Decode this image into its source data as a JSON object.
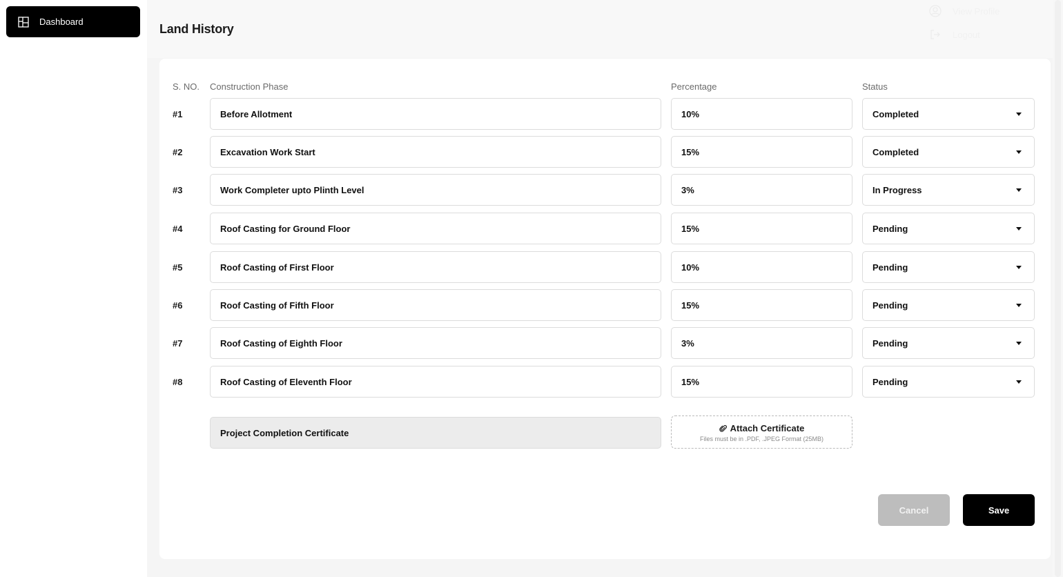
{
  "sidebar": {
    "items": [
      {
        "label": "Dashboard",
        "icon": "layout-icon"
      }
    ]
  },
  "header": {
    "title": "Land History",
    "user_menu": [
      {
        "label": "View Profile",
        "icon": "user-circle-icon"
      },
      {
        "label": "Logout",
        "icon": "logout-icon"
      }
    ]
  },
  "table": {
    "columns": {
      "sno": "S. NO.",
      "phase": "Construction Phase",
      "percentage": "Percentage",
      "status": "Status"
    },
    "rows": [
      {
        "sno": "#1",
        "phase": "Before Allotment",
        "percentage": "10%",
        "status": "Completed"
      },
      {
        "sno": "#2",
        "phase": "Excavation Work Start",
        "percentage": "15%",
        "status": "Completed"
      },
      {
        "sno": "#3",
        "phase": "Work Completer upto Plinth Level",
        "percentage": "3%",
        "status": "In Progress"
      },
      {
        "sno": "#4",
        "phase": "Roof Casting for Ground Floor",
        "percentage": "15%",
        "status": "Pending"
      },
      {
        "sno": "#5",
        "phase": "Roof Casting of First  Floor",
        "percentage": "10%",
        "status": "Pending"
      },
      {
        "sno": "#6",
        "phase": "Roof Casting of Fifth  Floor",
        "percentage": "15%",
        "status": "Pending"
      },
      {
        "sno": "#7",
        "phase": "Roof Casting of Eighth  Floor",
        "percentage": "3%",
        "status": "Pending"
      },
      {
        "sno": "#8",
        "phase": "Roof Casting of Eleventh Floor",
        "percentage": "15%",
        "status": "Pending"
      }
    ]
  },
  "certificate": {
    "label": "Project Completion Certificate",
    "attach_label": "Attach Certificate",
    "attach_hint": "Files must be in .PDF, .JPEG Format (25MB)",
    "attach_icon": "paperclip-icon"
  },
  "actions": {
    "cancel_label": "Cancel",
    "save_label": "Save"
  }
}
